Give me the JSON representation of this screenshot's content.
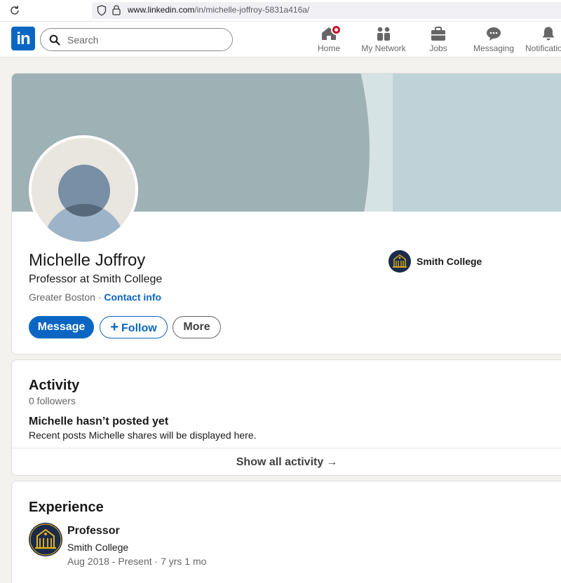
{
  "browser": {
    "url_domain": "www.linkedin.com",
    "url_path": "/in/michelle-joffroy-5831a416a/"
  },
  "nav": {
    "logo_text": "in",
    "search_placeholder": "Search",
    "items": [
      {
        "label": "Home",
        "icon": "home-icon"
      },
      {
        "label": "My Network",
        "icon": "network-icon"
      },
      {
        "label": "Jobs",
        "icon": "briefcase-icon"
      },
      {
        "label": "Messaging",
        "icon": "chat-icon"
      },
      {
        "label": "Notifications",
        "icon": "bell-icon"
      }
    ]
  },
  "profile": {
    "name": "Michelle Joffroy",
    "headline": "Professor at Smith College",
    "location": "Greater Boston",
    "separator": " · ",
    "contact_info": "Contact info",
    "organization": "Smith College",
    "actions": {
      "message": "Message",
      "follow": "Follow",
      "follow_icon": "+",
      "more": "More"
    }
  },
  "activity": {
    "title": "Activity",
    "followers": "0 followers",
    "empty_title": "Michelle hasn’t posted yet",
    "empty_text": "Recent posts Michelle shares will be displayed here.",
    "show_all": "Show all activity",
    "arrow": "→"
  },
  "experience": {
    "title": "Experience",
    "items": [
      {
        "role": "Professor",
        "organization": "Smith College",
        "dates": "Aug 2018 - Present · 7 yrs 1 mo"
      }
    ]
  },
  "colors": {
    "brand": "#0a66c2",
    "badge": "#cb112d",
    "college_navy": "#1b2b4b",
    "college_gold": "#e8b417"
  }
}
